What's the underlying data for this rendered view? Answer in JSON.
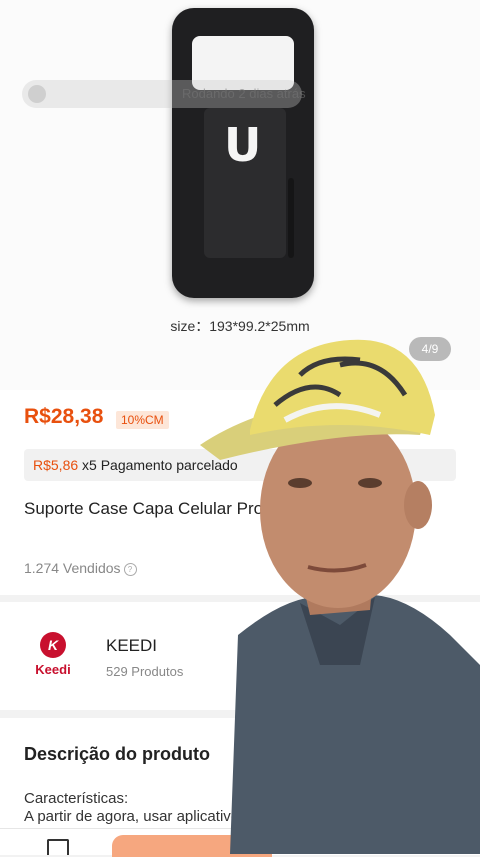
{
  "gallery": {
    "watermark": "Rodando 2 dias atrás",
    "size_caption": "size：193*99.2*25mm",
    "counter": "4/9"
  },
  "product": {
    "price": "R$28,38",
    "discount": "10%CM",
    "installment_amount": "R$5,86",
    "installment_text": "x5 Pagamento parcelado",
    "title": "Suporte Case Capa Celular Prova D'agua Magnetico",
    "sold": "1.274 Vendidos"
  },
  "store": {
    "logo_text": "Keedi",
    "name": "KEEDI",
    "products": "529 Produtos"
  },
  "description": {
    "title": "Descrição do produto",
    "subtitle": "Características:",
    "text": "A partir de agora, usar aplicativos"
  },
  "colors": {
    "accent": "#e8500e",
    "badge_bg": "#fde6d8",
    "brand_red": "#c8102e"
  }
}
